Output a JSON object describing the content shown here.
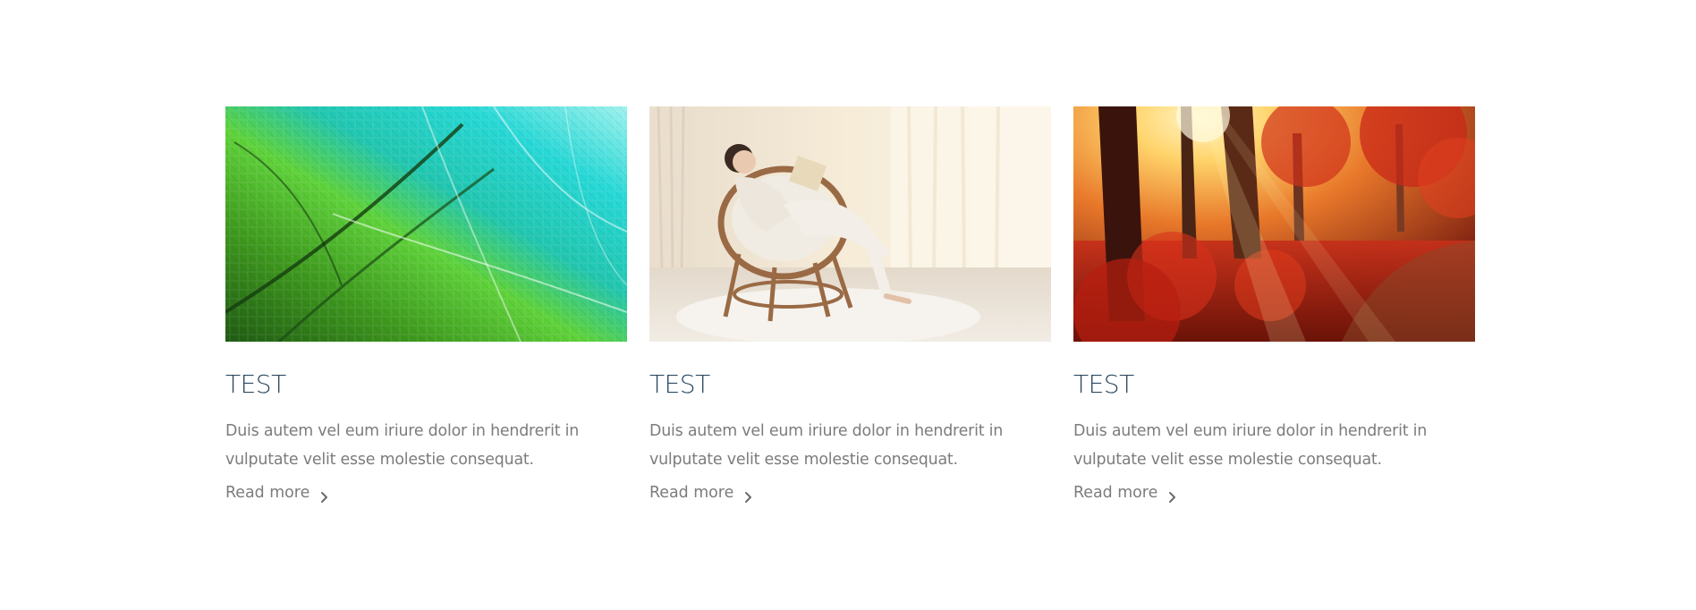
{
  "cards": [
    {
      "image": "leaf-veins-photo",
      "title": "TEST",
      "text": "Duis autem vel eum iriure dolor in hendrerit in vulputate velit esse molestie consequat.",
      "link_label": "Read more",
      "link_icon": "chevron-right-icon"
    },
    {
      "image": "woman-reading-photo",
      "title": "TEST",
      "text": "Duis autem vel eum iriure dolor in hendrerit in vulputate velit esse molestie consequat.",
      "link_label": "Read more",
      "link_icon": "chevron-right-icon"
    },
    {
      "image": "autumn-forest-photo",
      "title": "TEST",
      "text": "Duis autem vel eum iriure dolor in hendrerit in vulputate velit esse molestie consequat.",
      "link_label": "Read more",
      "link_icon": "chevron-right-icon"
    }
  ],
  "colors": {
    "title": "#2b4a63",
    "body_text": "#7c7c7c",
    "background": "#ffffff"
  }
}
